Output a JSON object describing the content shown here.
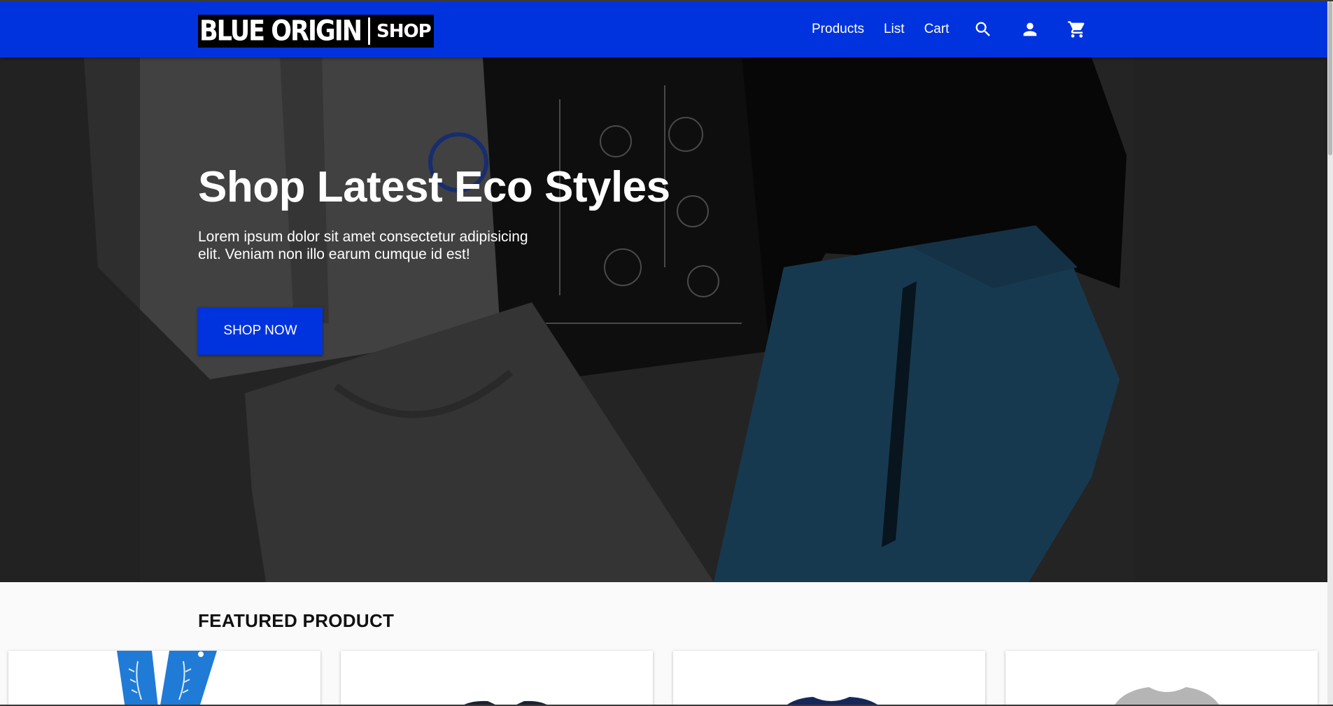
{
  "brand": {
    "name": "BLUE ORIGIN",
    "shop": "SHOP"
  },
  "nav": {
    "links": [
      "Products",
      "List",
      "Cart"
    ],
    "icons": [
      "search-icon",
      "account-icon",
      "shopping-cart-icon"
    ]
  },
  "hero": {
    "title": "Shop Latest Eco Styles",
    "text": "Lorem ipsum dolor sit amet consectetur adipisicing elit. Veniam non illo earum cumque id est!",
    "button": "SHOP NOW"
  },
  "featured": {
    "title": "FEATURED PRODUCT",
    "cards": [
      "blue-lanyard",
      "navy-shirt",
      "navy-tshirt",
      "grey-tshirt"
    ]
  },
  "colors": {
    "brand": "#0033dd",
    "background": "#fafafa",
    "text": "#111111"
  }
}
